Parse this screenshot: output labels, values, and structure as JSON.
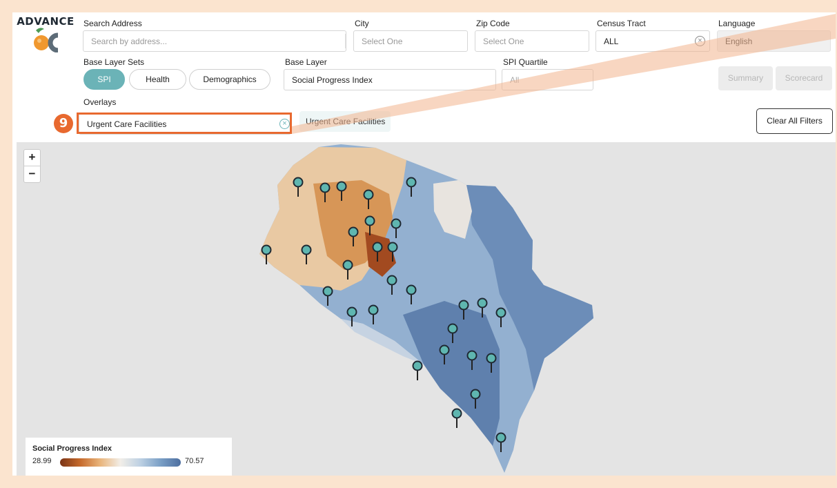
{
  "logo": {
    "text": "ADVANCE",
    "icon": "advance-oc-logo-icon"
  },
  "filters": {
    "search_address": {
      "label": "Search Address",
      "placeholder": "Search by address..."
    },
    "city": {
      "label": "City",
      "value": "Select One"
    },
    "zip": {
      "label": "Zip Code",
      "value": "Select One"
    },
    "census_tract": {
      "label": "Census Tract",
      "value": "ALL"
    },
    "language": {
      "label": "Language",
      "value": "English"
    },
    "base_layer_sets": {
      "label": "Base Layer Sets",
      "options": [
        "SPI",
        "Health",
        "Demographics"
      ],
      "selected": "SPI"
    },
    "base_layer": {
      "label": "Base Layer",
      "value": "Social Progress Index"
    },
    "spi_quartile": {
      "label": "SPI Quartile",
      "value": "All"
    },
    "overlays": {
      "label": "Overlays",
      "value": "Urgent Care Facilities",
      "chip": "Urgent Care Facilities"
    }
  },
  "buttons": {
    "summary": "Summary",
    "scorecard": "Scorecard",
    "clear_all": "Clear All Filters"
  },
  "annotation": {
    "step": "9",
    "color": "#e8692f"
  },
  "map": {
    "zoom_in": "+",
    "zoom_out": "−",
    "marker_icon": "map-pin-icon",
    "marker_color": "#5fb6b0",
    "legend": {
      "title": "Social Progress Index",
      "min": "28.99",
      "max": "70.57"
    }
  },
  "colors": {
    "accent": "#6bb3b7",
    "low": "#7a3416",
    "high": "#4e6fa0",
    "background": "#fbe4cf"
  }
}
